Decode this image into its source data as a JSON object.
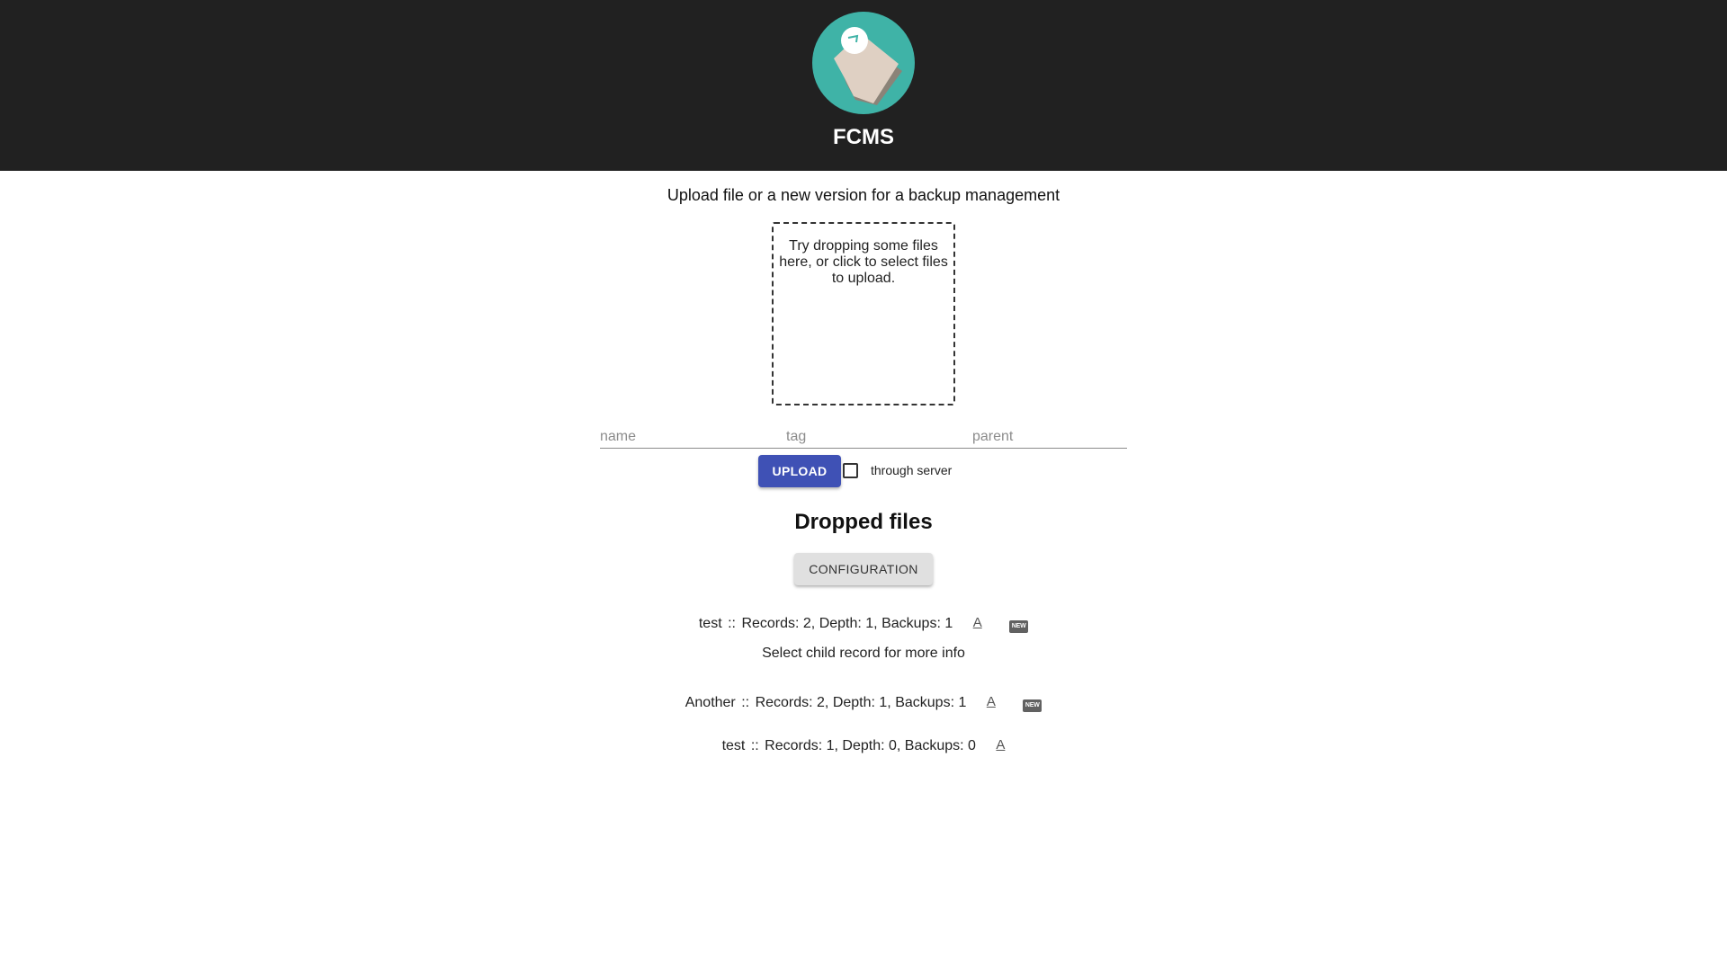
{
  "app": {
    "title": "FCMS"
  },
  "upload": {
    "subtitle": "Upload file or a new version for a backup management",
    "dropzone_text": "Try dropping some files here, or click to select files to upload.",
    "fields": [
      {
        "placeholder": "name",
        "value": ""
      },
      {
        "placeholder": "tag",
        "value": ""
      },
      {
        "placeholder": "parent",
        "value": ""
      }
    ],
    "upload_label": "UPLOAD",
    "through_server_label": "through server",
    "through_server_checked": false
  },
  "dropped": {
    "heading": "Dropped files",
    "config_label": "CONFIGURATION",
    "hint": "Select child record for more info",
    "records": [
      {
        "name": "test",
        "sep": "::",
        "stats": "Records: 2, Depth: 1, Backups: 1",
        "icon_a": "A",
        "badge": "NEW"
      },
      {
        "name": "Another",
        "sep": "::",
        "stats": "Records: 2, Depth: 1, Backups: 1",
        "icon_a": "A",
        "badge": "NEW"
      },
      {
        "name": "test",
        "sep": "::",
        "stats": "Records: 1, Depth: 0, Backups: 0",
        "icon_a": "A",
        "badge": ""
      }
    ]
  },
  "colors": {
    "header_bg": "#212121",
    "logo_bg": "#3fb3a7",
    "primary_button": "#3f51b5",
    "secondary_button": "#e0e0e0"
  },
  "icons": {
    "logo": "document-logo-icon",
    "download": "text-a-icon",
    "new_badge": "new-badge-icon"
  }
}
